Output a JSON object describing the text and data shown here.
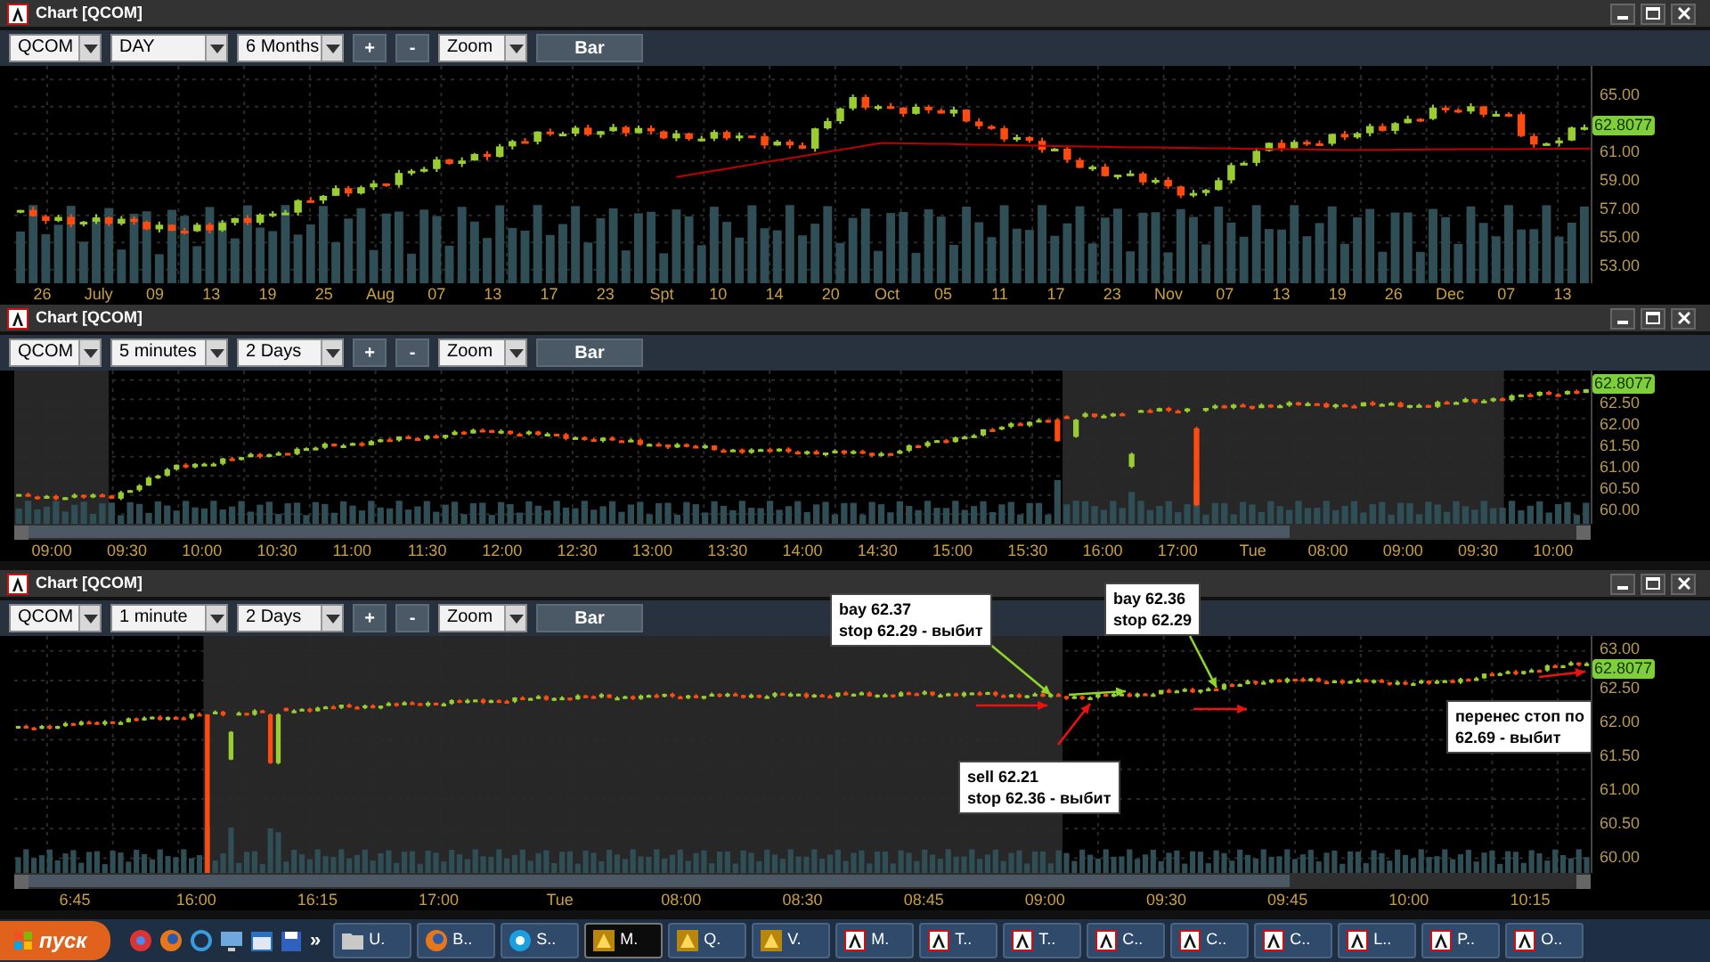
{
  "panels": [
    {
      "title": "Chart [QCOM]",
      "symbol": "QCOM",
      "interval": "DAY",
      "range": "6 Months",
      "zoom_in": "+",
      "zoom_out": "-",
      "zoom": "Zoom",
      "style": "Bar",
      "price": "62.8077",
      "moving_average": true,
      "y_labels": [
        "65.00",
        "61.00",
        "59.00",
        "57.00",
        "55.00",
        "53.00"
      ],
      "x_labels": [
        "26",
        "July",
        "09",
        "13",
        "19",
        "25",
        "Aug",
        "07",
        "13",
        "17",
        "23",
        "Spt",
        "10",
        "14",
        "20",
        "Oct",
        "05",
        "11",
        "17",
        "23",
        "Nov",
        "07",
        "13",
        "19",
        "26",
        "Dec",
        "07",
        "13"
      ]
    },
    {
      "title": "Chart [QCOM]",
      "symbol": "QCOM",
      "interval": "5 minutes",
      "range": "2 Days",
      "zoom_in": "+",
      "zoom_out": "-",
      "zoom": "Zoom",
      "style": "Bar",
      "price": "62.8077",
      "scrollbar": true,
      "y_labels": [
        "62.50",
        "62.00",
        "61.50",
        "61.00",
        "60.50",
        "60.00"
      ],
      "x_labels": [
        "09:00",
        "09:30",
        "10:00",
        "10:30",
        "11:00",
        "11:30",
        "12:00",
        "12:30",
        "13:00",
        "13:30",
        "14:00",
        "14:30",
        "15:00",
        "15:30",
        "16:00",
        "17:00",
        "Tue",
        "08:00",
        "09:00",
        "09:30",
        "10:00"
      ]
    },
    {
      "title": "Chart [QCOM]",
      "symbol": "QCOM",
      "interval": "1 minute",
      "range": "2 Days",
      "zoom_in": "+",
      "zoom_out": "-",
      "zoom": "Zoom",
      "style": "Bar",
      "price": "62.8077",
      "scrollbar": true,
      "y_labels": [
        "63.00",
        "62.50",
        "62.00",
        "61.50",
        "61.00",
        "60.50",
        "60.00"
      ],
      "x_labels": [
        "6:45",
        "16:00",
        "16:15",
        "17:00",
        "Tue",
        "08:00",
        "08:30",
        "08:45",
        "09:00",
        "09:30",
        "09:45",
        "10:00",
        "10:15"
      ],
      "notes": [
        {
          "lines": [
            "bay 62.37",
            "stop 62.29 - выбит"
          ]
        },
        {
          "lines": [
            "sell 62.21",
            "stop 62.36 - выбит"
          ]
        },
        {
          "lines": [
            "bay 62.36",
            "stop 62.29"
          ]
        },
        {
          "lines": [
            "перенес стоп по",
            "62.69 - выбит"
          ]
        }
      ]
    }
  ],
  "taskbar": {
    "start": "пуск",
    "more": "»",
    "items": [
      {
        "label": "U.",
        "kind": "folder",
        "selected": false
      },
      {
        "label": "B..",
        "kind": "browser",
        "selected": false
      },
      {
        "label": "S..",
        "kind": "skype",
        "selected": false
      },
      {
        "label": "M.",
        "kind": "app",
        "selected": true
      },
      {
        "label": "Q.",
        "kind": "app",
        "selected": false
      },
      {
        "label": "V.",
        "kind": "app",
        "selected": false
      },
      {
        "label": "M.",
        "kind": "chart",
        "selected": false
      },
      {
        "label": "T..",
        "kind": "chart",
        "selected": false
      },
      {
        "label": "T..",
        "kind": "chart",
        "selected": false
      },
      {
        "label": "C..",
        "kind": "chart",
        "selected": false
      },
      {
        "label": "C..",
        "kind": "chart",
        "selected": false
      },
      {
        "label": "C..",
        "kind": "chart",
        "selected": false
      },
      {
        "label": "L..",
        "kind": "chart",
        "selected": false
      },
      {
        "label": "P..",
        "kind": "chart",
        "selected": false
      },
      {
        "label": "O..",
        "kind": "chart",
        "selected": false
      }
    ]
  }
}
